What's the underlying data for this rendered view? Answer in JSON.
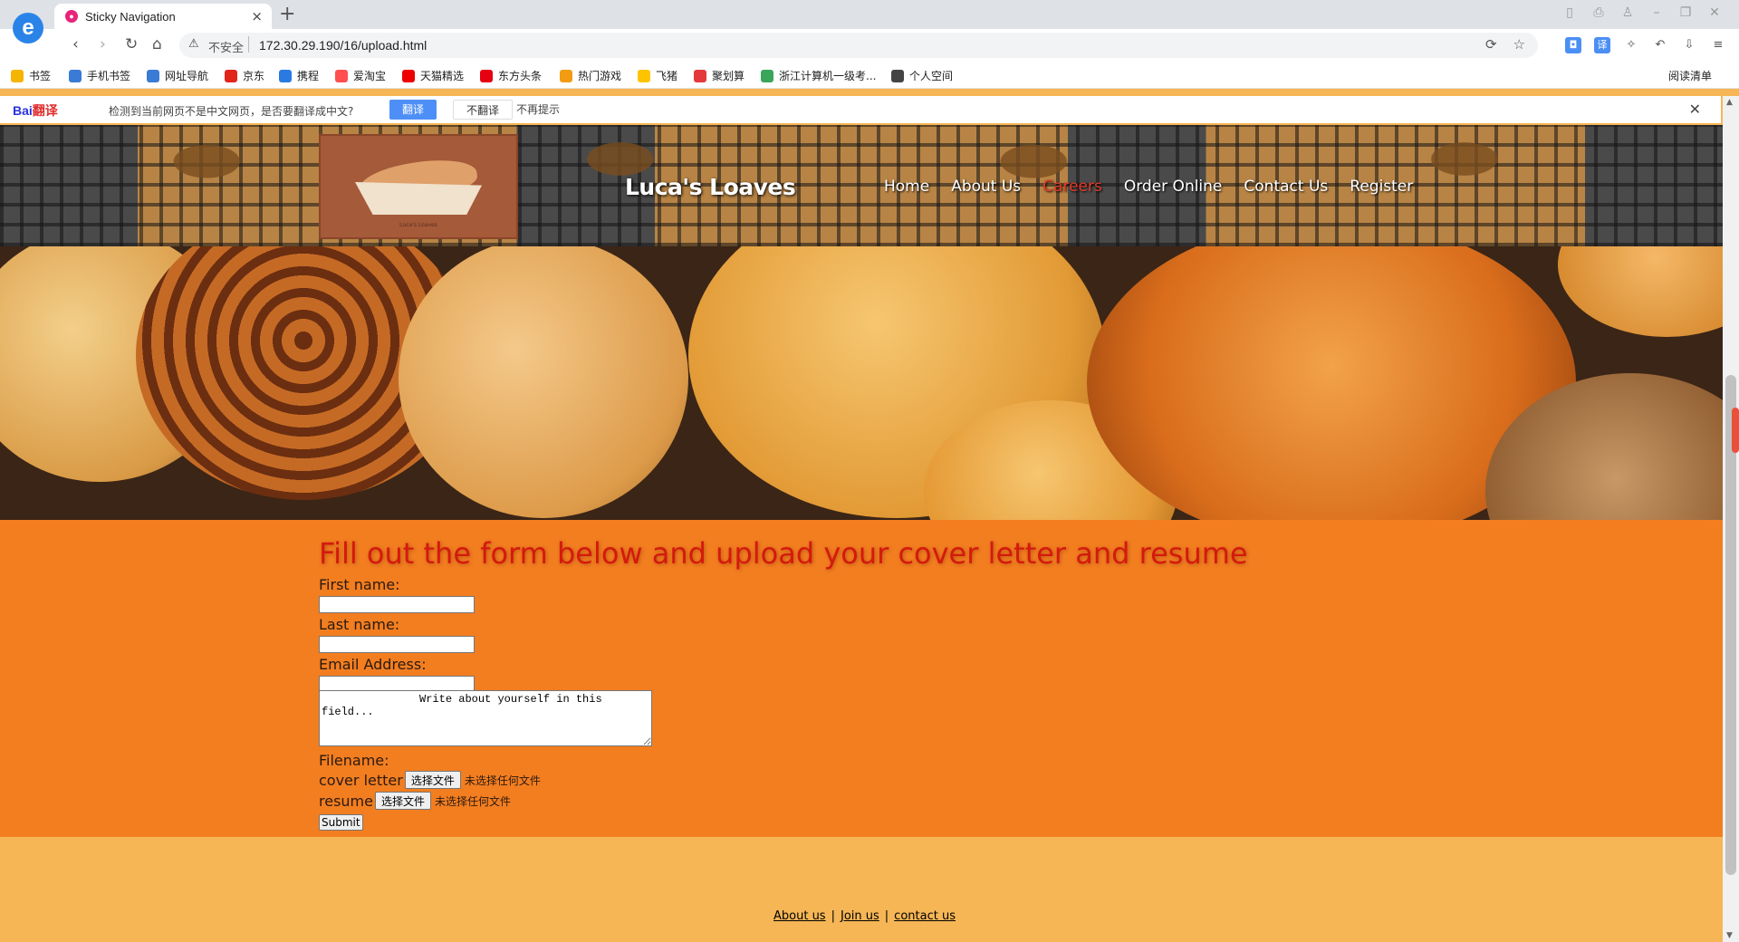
{
  "browser": {
    "tab_title": "Sticky Navigation",
    "url": "172.30.29.190/16/upload.html",
    "insecure_label": "不安全",
    "bookmarks": [
      {
        "label": "书签",
        "color": "#f5b400"
      },
      {
        "label": "手机书签",
        "color": "#3a7bd5"
      },
      {
        "label": "网址导航",
        "color": "#3a7bd5"
      },
      {
        "label": "京东",
        "color": "#e1251b"
      },
      {
        "label": "携程",
        "color": "#2a7ae2"
      },
      {
        "label": "爱淘宝",
        "color": "#ff4f4f"
      },
      {
        "label": "天猫精选",
        "color": "#e00"
      },
      {
        "label": "东方头条",
        "color": "#e60012"
      },
      {
        "label": "热门游戏",
        "color": "#f39c12"
      },
      {
        "label": "飞猪",
        "color": "#ffc400"
      },
      {
        "label": "聚划算",
        "color": "#e4393c"
      },
      {
        "label": "浙江计算机一级考...",
        "color": "#3ba55c"
      },
      {
        "label": "个人空间",
        "color": "#444"
      }
    ],
    "reader_label": "阅读清单"
  },
  "translate_bar": {
    "message": "检测到当前网页不是中文网页，是否要翻译成中文?",
    "translate_button": "翻译",
    "no_translate_button": "不翻译",
    "never_button": "不再提示",
    "logo": "Bai",
    "logo_suffix": "翻译"
  },
  "site": {
    "title": "Luca's Loaves",
    "logo_caption": "Luca's Loaves",
    "nav": [
      "Home",
      "About Us",
      "Careers",
      "Order Online",
      "Contact Us",
      "Register"
    ],
    "current_nav_index": 2
  },
  "form": {
    "heading": "Fill out the form below and upload your cover letter and resume",
    "first_name_label": "First name:",
    "last_name_label": "Last name:",
    "email_label": "Email Address:",
    "textarea_placeholder": "               Write about yourself in this field...",
    "filename_label": "Filename:",
    "cover_letter_label": "cover letter",
    "resume_label": "resume",
    "choose_file_button": "选择文件",
    "no_file_text": "未选择任何文件",
    "submit_label": "Submit"
  },
  "footer": {
    "links": [
      "About us",
      "Join us",
      "contact us"
    ],
    "separator": "|"
  }
}
